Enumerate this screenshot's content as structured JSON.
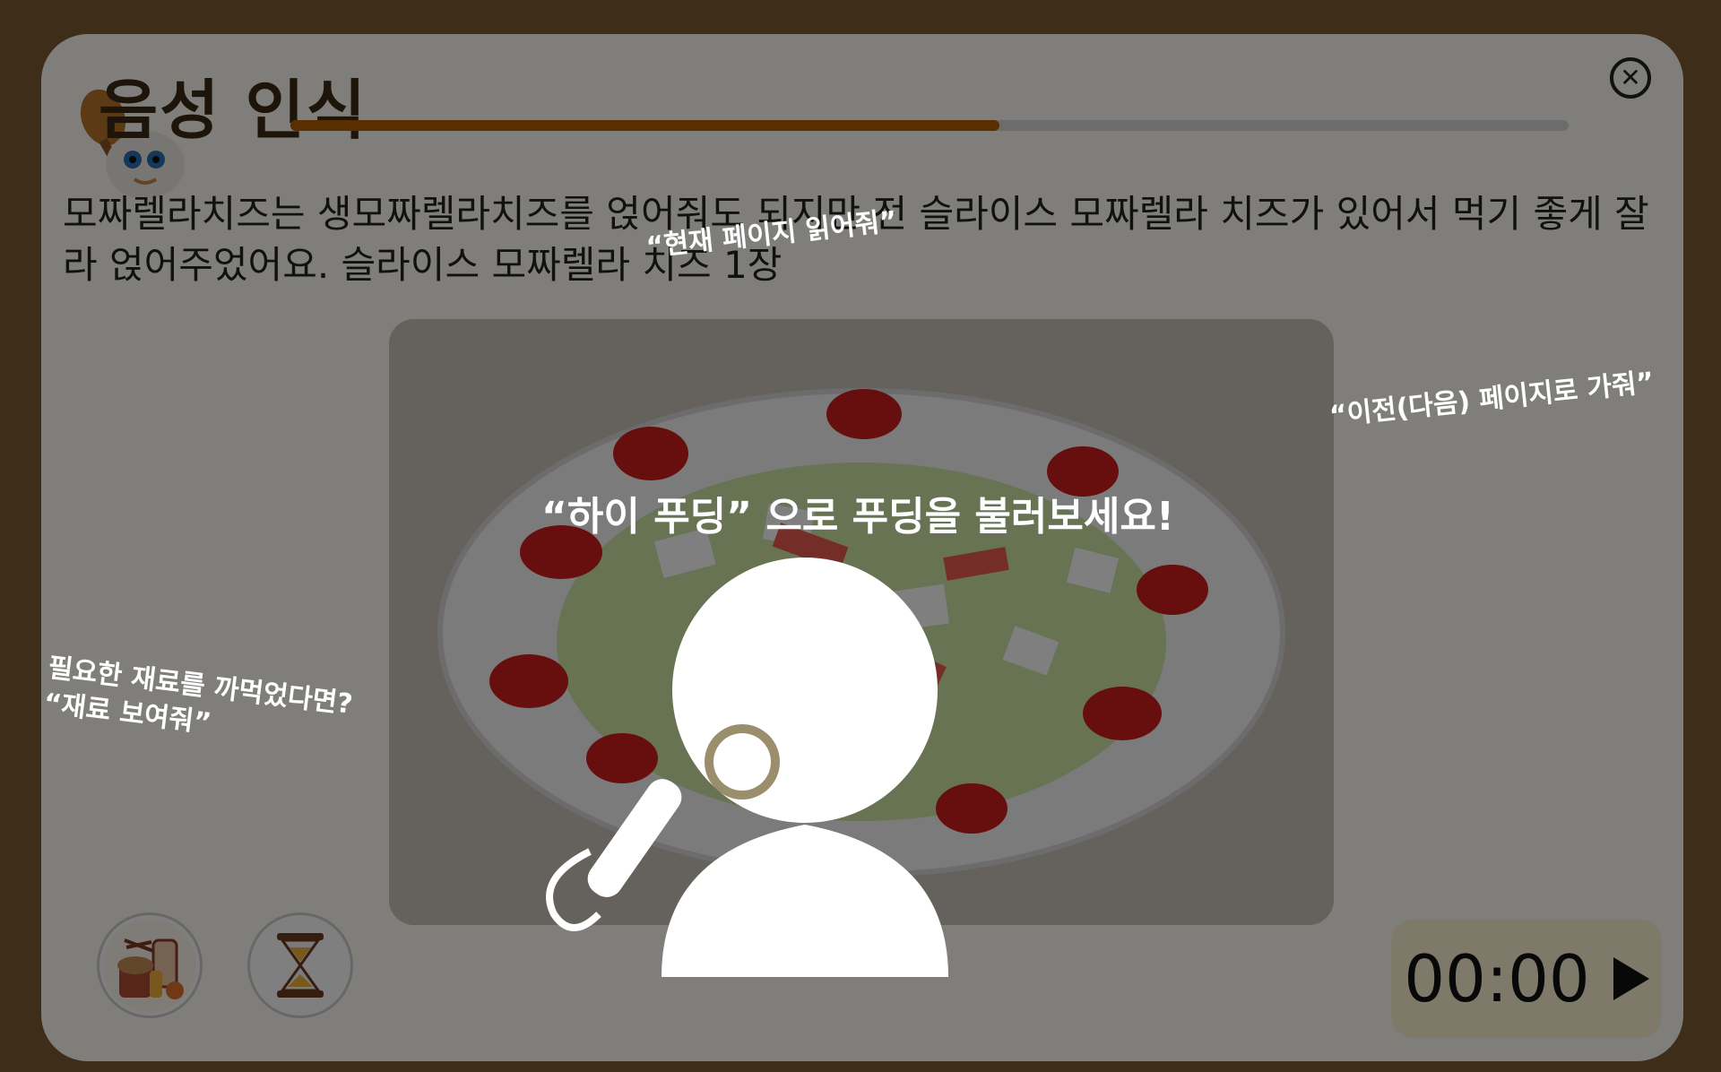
{
  "header": {
    "title": "음성 인식",
    "progress_fraction": 0.555
  },
  "description": "모짜렐라치즈는 생모짜렐라치즈를 얹어줘도 되지만 전 슬라이스 모짜렐라 치즈가 있어서 먹기 좋게 잘라 얹어주었어요. 슬라이스 모짜렐라 치즈 1장",
  "buttons": {
    "ingredients_icon": "ingredients-icon",
    "timer_icon": "hourglass-icon",
    "close_icon": "close-icon"
  },
  "timer": {
    "time": "00:00",
    "play_icon": "play-icon"
  },
  "voice_overlay": {
    "hint_current_page": "“현재 페이지 읽어줘”",
    "hint_navigation": "“이전(다음) 페이지로 가줘”",
    "hint_missing_ingredient": "필요한 재료를 까먹었다면?\n“재료 보여줘”",
    "call_prompt": "“하이 푸딩” 으로 푸딩을 불러보세요!"
  },
  "colors": {
    "background": "#7d5a33",
    "accent": "#b35f00",
    "timer_bg": "#fff3d2"
  }
}
